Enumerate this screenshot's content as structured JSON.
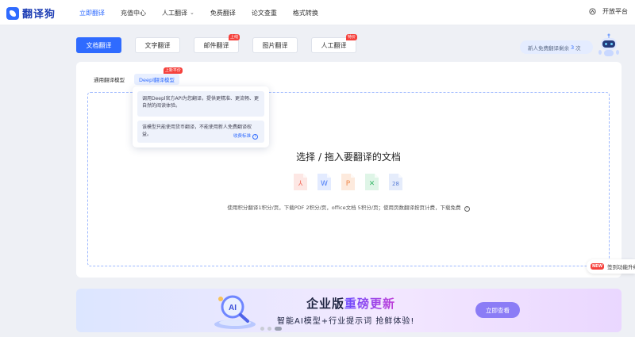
{
  "app": {
    "logo_text": "翻译狗"
  },
  "nav": {
    "items": [
      {
        "label": "立即翻译",
        "active": true
      },
      {
        "label": "充值中心"
      },
      {
        "label": "人工翻译",
        "has_caret": true
      },
      {
        "label": "免费翻译"
      },
      {
        "label": "论文查重"
      },
      {
        "label": "格式转换"
      }
    ],
    "open_platform": "开放平台"
  },
  "tabs": [
    {
      "label": "文档翻译",
      "active": true
    },
    {
      "label": "文字翻译"
    },
    {
      "label": "邮件翻译",
      "badge": "上线"
    },
    {
      "label": "图片翻译"
    },
    {
      "label": "人工翻译",
      "badge": "特价"
    }
  ],
  "promo": {
    "prefix": "新人免费翻译剩余",
    "count": "3",
    "unit": "次"
  },
  "subtabs": [
    {
      "label": "通用翻译模型"
    },
    {
      "label": "Deepl翻译模型",
      "active": true,
      "badge": "上新平价"
    }
  ],
  "tooltip": {
    "line1": "调用Deepl官方API为您翻译，提供更精准、更流畅、更自然的阅读体验。",
    "line2": "该模型只能使用货币翻译，不能使用新人免费翻译权益。",
    "link": "收费标准"
  },
  "dropzone": {
    "title": "选择 / 拖入要翻译的文档",
    "note": "使用积分翻译1积分/页，下载PDF 2积分/页，office文档 5积分/页；使用页数翻译按页计费，下载免费",
    "file_icons": [
      {
        "icon": "pdf-icon",
        "glyph": "⅄",
        "color": "#f26b5b",
        "bg": "#fde7e4"
      },
      {
        "icon": "word-icon",
        "glyph": "W",
        "color": "#4a7cf7",
        "bg": "#e3ebff"
      },
      {
        "icon": "ppt-icon",
        "glyph": "P",
        "color": "#f0884a",
        "bg": "#fdeadd"
      },
      {
        "icon": "excel-icon",
        "glyph": "✕",
        "color": "#3cb96b",
        "bg": "#dff5e7"
      },
      {
        "icon": "multilang-icon",
        "glyph": "28",
        "color": "#5b7fd6",
        "bg": "#e5ecfb"
      }
    ]
  },
  "side_float": {
    "badge": "NEW",
    "label": "签到功能升级"
  },
  "banner": {
    "title_a": "企业版",
    "title_b": "重磅更新",
    "subtitle": "智能AI模型+行业提示词 抢鲜体验!",
    "button": "立即查看"
  },
  "colors": {
    "accent": "#2f6bff",
    "badge": "#f5413c"
  }
}
